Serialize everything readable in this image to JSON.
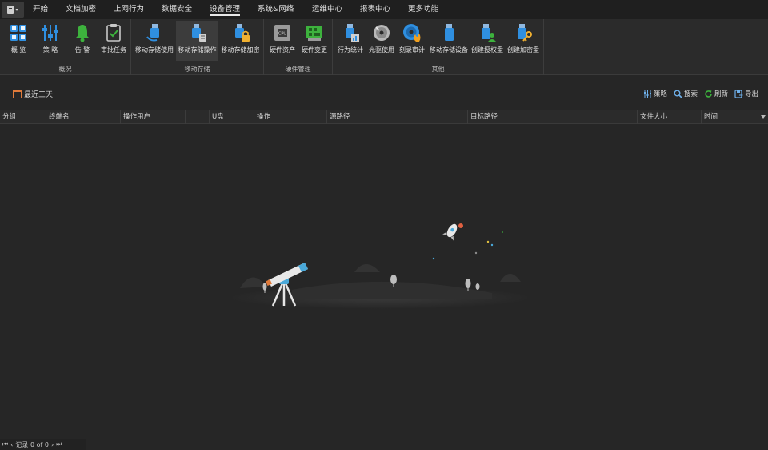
{
  "menu": {
    "tabs": [
      {
        "label": "开始"
      },
      {
        "label": "文档加密"
      },
      {
        "label": "上网行为"
      },
      {
        "label": "数据安全"
      },
      {
        "label": "设备管理"
      },
      {
        "label": "系统&网络"
      },
      {
        "label": "运维中心"
      },
      {
        "label": "报表中心"
      },
      {
        "label": "更多功能"
      }
    ],
    "active": "设备管理"
  },
  "ribbon": {
    "groups": [
      {
        "label": "概况",
        "buttons": [
          {
            "label": "概 览"
          },
          {
            "label": "策 略"
          },
          {
            "label": "告 警"
          },
          {
            "label": "审批任务"
          }
        ]
      },
      {
        "label": "移动存储",
        "buttons": [
          {
            "label": "移动存储使用"
          },
          {
            "label": "移动存储操作"
          },
          {
            "label": "移动存储加密"
          }
        ]
      },
      {
        "label": "硬件管理",
        "buttons": [
          {
            "label": "硬件资产"
          },
          {
            "label": "硬件变更"
          }
        ]
      },
      {
        "label": "其他",
        "buttons": [
          {
            "label": "行为统计"
          },
          {
            "label": "光驱使用"
          },
          {
            "label": "刻录审计"
          },
          {
            "label": "移动存储设备"
          },
          {
            "label": "创建授权盘"
          },
          {
            "label": "创建加密盘"
          }
        ]
      }
    ]
  },
  "toolbar": {
    "range_label": "最近三天",
    "strategy_label": "策略",
    "search_label": "搜索",
    "refresh_label": "刷新",
    "export_label": "导出"
  },
  "table": {
    "columns": [
      "分组",
      "终端名",
      "操作用户",
      "",
      "U盘",
      "操作",
      "源路径",
      "目标路径",
      "文件大小",
      "时间"
    ]
  },
  "pager": {
    "record_text": "记录 0 of 0"
  },
  "colors": {
    "accent_blue": "#2f8fe0",
    "accent_green": "#3db23d",
    "accent_orange": "#e07a3a"
  }
}
